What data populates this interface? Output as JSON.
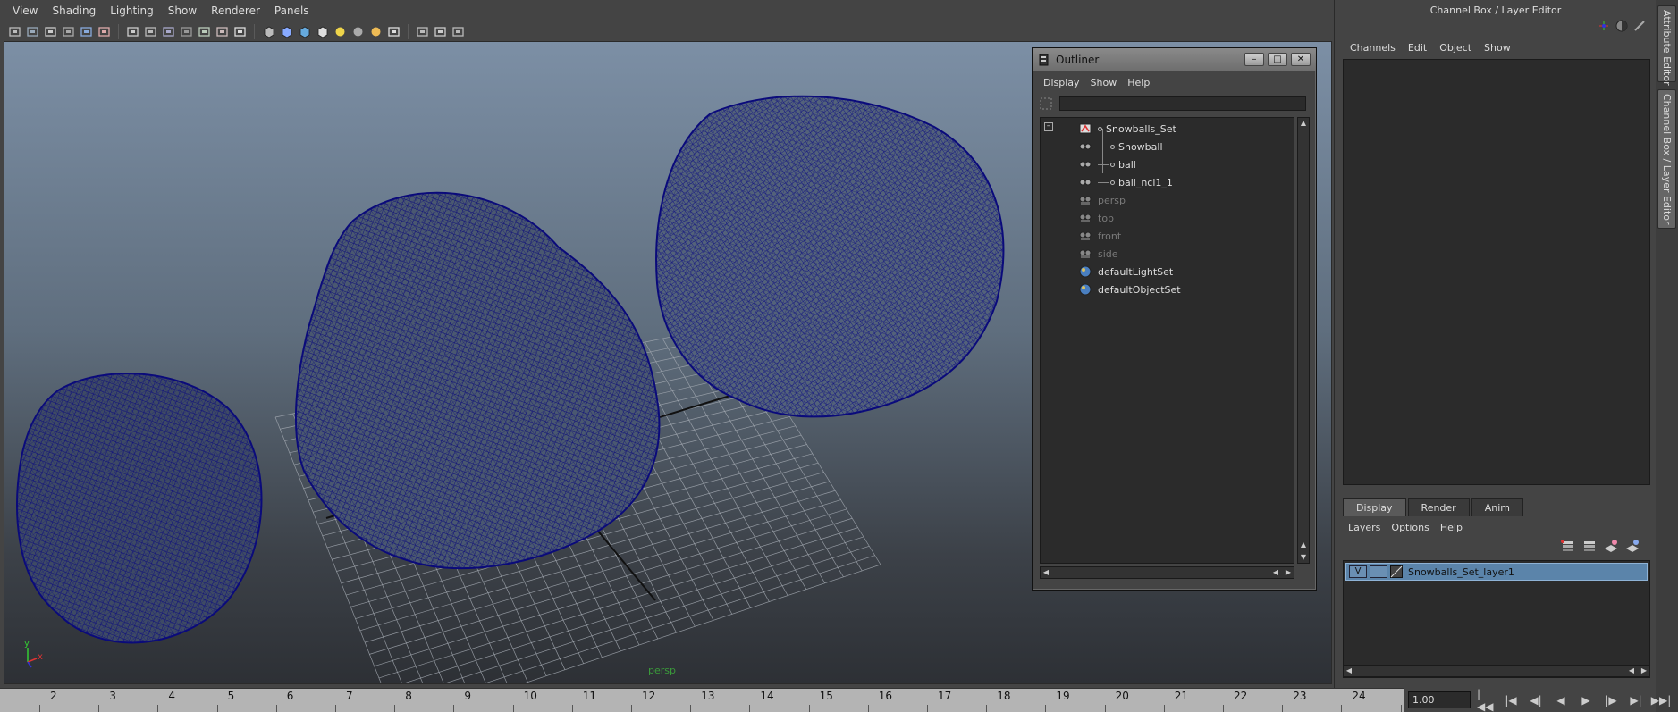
{
  "viewport": {
    "menu": [
      "View",
      "Shading",
      "Lighting",
      "Show",
      "Renderer",
      "Panels"
    ],
    "camera_label": "persp",
    "axis": {
      "y": "y",
      "x": "x"
    },
    "toolbar_icons": [
      "camera-icon",
      "camera-attr-icon",
      "bookmark-icon",
      "image-plane-icon",
      "2d-pan-icon",
      "grease-pencil-icon",
      "grid-icon",
      "film-gate-icon",
      "resolution-gate-icon",
      "gate-mask-icon",
      "field-chart-icon",
      "safe-action-icon",
      "safe-title-icon",
      "wireframe-icon",
      "smooth-shade-icon",
      "shade-wire-icon",
      "textured-icon",
      "default-light-icon",
      "all-lights-icon",
      "shadows-icon",
      "isolate-icon",
      "xray-icon",
      "xray-joint-icon",
      "ambient-occlusion-icon"
    ]
  },
  "timeline": {
    "ticks": [
      "2",
      "3",
      "4",
      "5",
      "6",
      "7",
      "8",
      "9",
      "10",
      "11",
      "12",
      "13",
      "14",
      "15",
      "16",
      "17",
      "18",
      "19",
      "20",
      "21",
      "22",
      "23",
      "24"
    ],
    "current_time": "1.00"
  },
  "outliner": {
    "title": "Outliner",
    "menu": [
      "Display",
      "Show",
      "Help"
    ],
    "filter_value": "",
    "items": [
      {
        "label": "Snowballs_Set",
        "type": "set",
        "indent": 0,
        "dim": false
      },
      {
        "label": "Snowball",
        "type": "mesh",
        "indent": 1,
        "dim": false
      },
      {
        "label": "ball",
        "type": "mesh",
        "indent": 1,
        "dim": false
      },
      {
        "label": "ball_ncl1_1",
        "type": "mesh",
        "indent": 1,
        "dim": false
      },
      {
        "label": "persp",
        "type": "camera",
        "indent": 0,
        "dim": true
      },
      {
        "label": "top",
        "type": "camera",
        "indent": 0,
        "dim": true
      },
      {
        "label": "front",
        "type": "camera",
        "indent": 0,
        "dim": true
      },
      {
        "label": "side",
        "type": "camera",
        "indent": 0,
        "dim": true
      },
      {
        "label": "defaultLightSet",
        "type": "objectset",
        "indent": 0,
        "dim": false
      },
      {
        "label": "defaultObjectSet",
        "type": "objectset",
        "indent": 0,
        "dim": false
      }
    ]
  },
  "channel_box": {
    "title": "Channel Box / Layer Editor",
    "menu": [
      "Channels",
      "Edit",
      "Object",
      "Show"
    ]
  },
  "layer_editor": {
    "tabs": [
      "Display",
      "Render",
      "Anim"
    ],
    "active_tab": "Display",
    "menu": [
      "Layers",
      "Options",
      "Help"
    ],
    "layer": {
      "visible": "V",
      "name": "Snowballs_Set_layer1"
    }
  },
  "side_tabs": [
    "Attribute Editor",
    "Channel Box / Layer Editor"
  ],
  "colors": {
    "wire": "#0a0a7a",
    "selection": "#5b84aa",
    "camera_text": "#3a9a3a"
  }
}
